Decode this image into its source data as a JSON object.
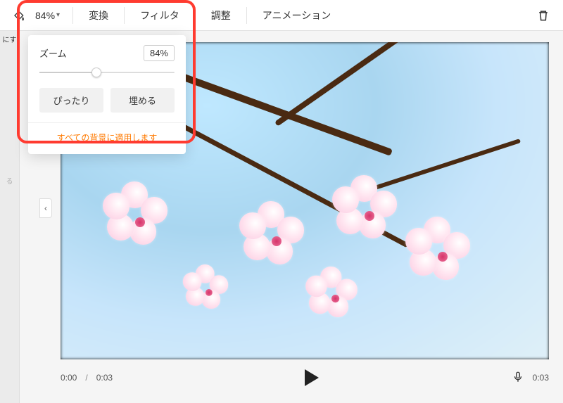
{
  "toolbar": {
    "zoom_level": "84%",
    "transform": "変換",
    "filter": "フィルタ",
    "adjust": "調整",
    "animation": "アニメーション"
  },
  "left_strip": {
    "text_fragment_top": "にす",
    "text_fragment_mid": "る"
  },
  "zoom_popover": {
    "title": "ズーム",
    "value": "84%",
    "fit_label": "ぴったり",
    "fill_label": "埋める",
    "apply_all": "すべての背景に適用します"
  },
  "transport": {
    "current": "0:00",
    "duration": "0:03",
    "right_time": "0:03"
  },
  "icons": {
    "fill_bucket": "paint-bucket-icon",
    "delete": "trash-icon",
    "mic": "mic-icon",
    "chevron_left": "chevron-left-icon",
    "chevron_down": "chevron-down-icon",
    "play": "play-icon"
  }
}
